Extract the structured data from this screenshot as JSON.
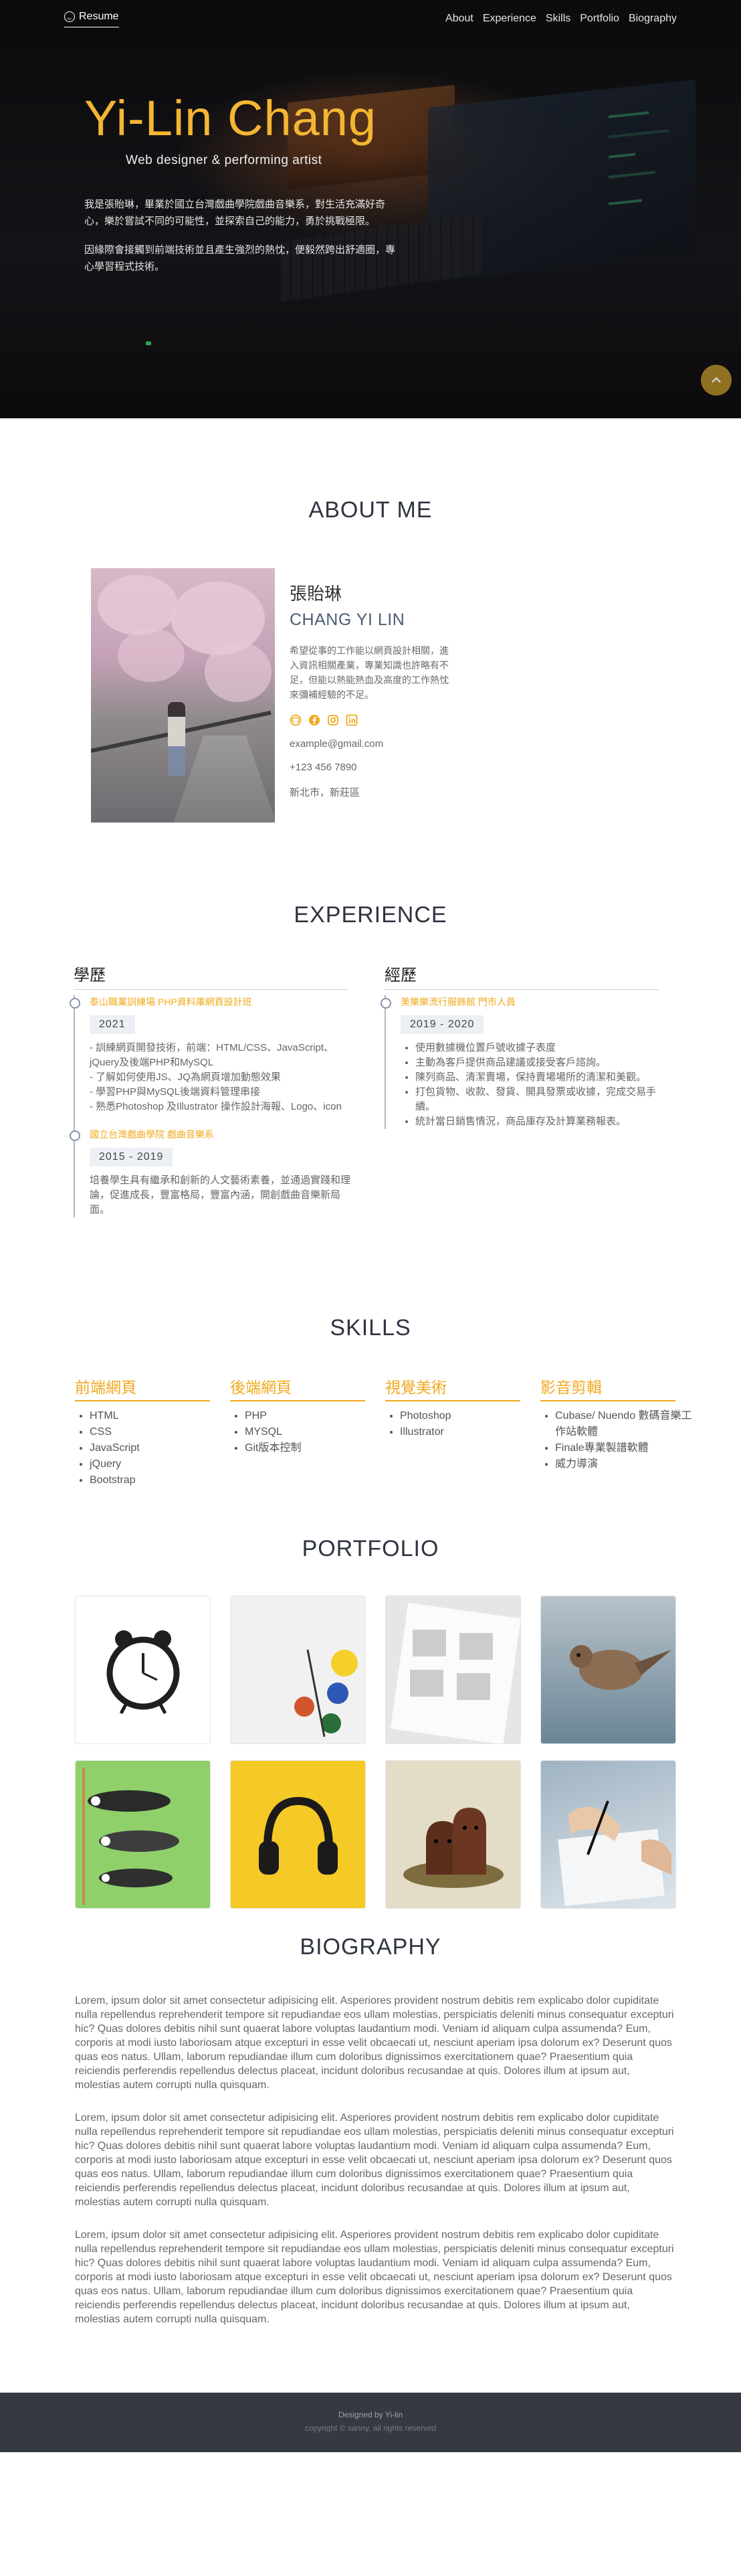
{
  "brand": {
    "label": "Resume",
    "icon": "smile-icon"
  },
  "nav": [
    {
      "label": "About"
    },
    {
      "label": "Experience"
    },
    {
      "label": "Skills"
    },
    {
      "label": "Portfolio"
    },
    {
      "label": "Biography"
    }
  ],
  "hero": {
    "name": "Yi-Lin Chang",
    "tagline": "Web designer & performing artist",
    "paragraphs": [
      "我是張貽琳，畢業於國立台灣戲曲學院戲曲音樂系，對生活充滿好奇心，樂於嘗試不同的可能性，並探索自己的能力，勇於挑戰極限。",
      "因緣際會接觸到前端技術並且產生強烈的熱忱，便毅然跨出舒適圈，專心學習程式技術。"
    ]
  },
  "about": {
    "title": "ABOUT ME",
    "name_cn": "張貽琳",
    "name_en": "CHANG YI LIN",
    "desc": "希望從事的工作能以網頁設計相關，進入資訊相關產業，專業知識也許略有不足，但能以熱能熱血及高度的工作熱忱來彌補經驗的不足。",
    "socials": [
      "github-icon",
      "facebook-icon",
      "instagram-icon",
      "linkedin-icon"
    ],
    "email": "example@gmail.com",
    "phone": "+123 456 7890",
    "location": "新北市，新莊區"
  },
  "experience": {
    "title": "EXPERIENCE",
    "education": {
      "heading": "學歷",
      "items": [
        {
          "title": "泰山職業訓練場 PHP資料庫網頁設計班",
          "date": "2021",
          "body": [
            "- 訓練網頁開發技術，前端：HTML/CSS、JavaScript、jQuery及後端PHP和MySQL",
            "- 了解如何使用JS、JQ為網頁增加動態效果",
            "- 學習PHP與MySQL後端資料管理串接",
            "- 熟悉Photoshop 及Illustrator 操作設計海報、Logo、icon"
          ]
        },
        {
          "title": "國立台灣戲曲學院 戲曲音樂系",
          "date": "2015 - 2019",
          "body": [
            "培養學生具有繼承和創新的人文藝術素養，並通過實踐和理論，促進成長，豐富格局，豐富內涵，開創戲曲音樂新局面。"
          ]
        }
      ]
    },
    "work": {
      "heading": "經歷",
      "items": [
        {
          "title": "美樂樂流行服飾館 門市人員",
          "date": "2019 - 2020",
          "body": [
            "使用數據機位置戶號收據子表度",
            "主動為客戶提供商品建議或接受客戶諮詢。",
            "陳列商品、清潔賣場，保持賣場場所的清潔和美觀。",
            "打包貨物、收款、發貨、開具發票或收據，完成交易手續。",
            "統計當日銷售情況，商品庫存及計算業務報表。"
          ]
        }
      ]
    }
  },
  "skills": {
    "title": "SKILLS",
    "groups": [
      {
        "heading": "前端網頁",
        "items": [
          "HTML",
          "CSS",
          "JavaScript",
          "jQuery",
          "Bootstrap"
        ]
      },
      {
        "heading": "後端網頁",
        "items": [
          "PHP",
          "MYSQL",
          "Git版本控制"
        ]
      },
      {
        "heading": "視覺美術",
        "items": [
          "Photoshop",
          "Illustrator"
        ]
      },
      {
        "heading": "影音剪輯",
        "items": [
          "Cubase/ Nuendo 數碼音樂工作站軟體",
          "Finale專業製譜軟體",
          "威力導演"
        ]
      }
    ]
  },
  "portfolio": {
    "title": "PORTFOLIO",
    "items": [
      "clock",
      "paint",
      "calendar",
      "bird",
      "koinobori",
      "headphones",
      "diglett",
      "writing"
    ]
  },
  "biography": {
    "title": "BIOGRAPHY",
    "paragraphs": [
      "Lorem, ipsum dolor sit amet consectetur adipisicing elit. Asperiores provident nostrum debitis rem explicabo dolor cupiditate nulla repellendus reprehenderit tempore sit repudiandae eos ullam molestias, perspiciatis deleniti minus consequatur excepturi hic? Quas dolores debitis nihil sunt quaerat labore voluptas laudantium modi. Veniam id aliquam culpa assumenda? Eum, corporis at modi iusto laboriosam atque excepturi in esse velit obcaecati ut, nesciunt aperiam ipsa dolorum ex? Deserunt quos quas eos natus. Ullam, laborum repudiandae illum cum doloribus dignissimos exercitationem quae? Praesentium quia reiciendis perferendis repellendus delectus placeat, incidunt doloribus recusandae at quis. Dolores illum at ipsum aut, molestias autem corrupti nulla quisquam.",
      "Lorem, ipsum dolor sit amet consectetur adipisicing elit. Asperiores provident nostrum debitis rem explicabo dolor cupiditate nulla repellendus reprehenderit tempore sit repudiandae eos ullam molestias, perspiciatis deleniti minus consequatur excepturi hic? Quas dolores debitis nihil sunt quaerat labore voluptas laudantium modi. Veniam id aliquam culpa assumenda? Eum, corporis at modi iusto laboriosam atque excepturi in esse velit obcaecati ut, nesciunt aperiam ipsa dolorum ex? Deserunt quos quas eos natus. Ullam, laborum repudiandae illum cum doloribus dignissimos exercitationem quae? Praesentium quia reiciendis perferendis repellendus delectus placeat, incidunt doloribus recusandae at quis. Dolores illum at ipsum aut, molestias autem corrupti nulla quisquam.",
      "Lorem, ipsum dolor sit amet consectetur adipisicing elit. Asperiores provident nostrum debitis rem explicabo dolor cupiditate nulla repellendus reprehenderit tempore sit repudiandae eos ullam molestias, perspiciatis deleniti minus consequatur excepturi hic? Quas dolores debitis nihil sunt quaerat labore voluptas laudantium modi. Veniam id aliquam culpa assumenda? Eum, corporis at modi iusto laboriosam atque excepturi in esse velit obcaecati ut, nesciunt aperiam ipsa dolorum ex? Deserunt quos quas eos natus. Ullam, laborum repudiandae illum cum doloribus dignissimos exercitationem quae? Praesentium quia reiciendis perferendis repellendus delectus placeat, incidunt doloribus recusandae at quis. Dolores illum at ipsum aut, molestias autem corrupti nulla quisquam."
    ]
  },
  "footer": {
    "line1": "Designed by Yi-lin",
    "line2": "copyright © sanny, all rights reserved"
  },
  "colors": {
    "accent": "#f0a91d",
    "hero_name": "#f4b632",
    "footer_bg": "#343a40",
    "hero_bg": "#0c0c0e"
  }
}
